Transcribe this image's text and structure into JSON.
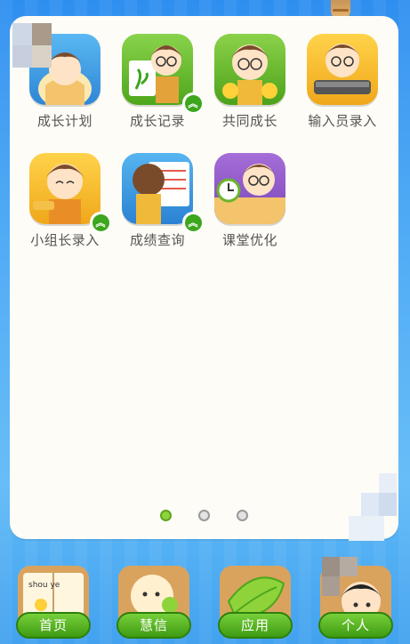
{
  "apps": [
    {
      "id": "growth-plan",
      "label": "成长计划",
      "badge": false
    },
    {
      "id": "growth-record",
      "label": "成长记录",
      "badge": true
    },
    {
      "id": "grow-together",
      "label": "共同成长",
      "badge": false
    },
    {
      "id": "input-entry",
      "label": "输入员录入",
      "badge": false
    },
    {
      "id": "group-leader-entry",
      "label": "小组长录入",
      "badge": true
    },
    {
      "id": "score-query",
      "label": "成绩查询",
      "badge": true
    },
    {
      "id": "class-optimize",
      "label": "课堂优化",
      "badge": false
    }
  ],
  "pager": {
    "count": 3,
    "active": 0
  },
  "nav": {
    "home": "首页",
    "message": "慧信",
    "apps": "应用",
    "profile": "个人",
    "home_book_text": "shou ye"
  },
  "colors": {
    "accent_green": "#3ca61d",
    "bg_blue": "#3f9ef2"
  }
}
